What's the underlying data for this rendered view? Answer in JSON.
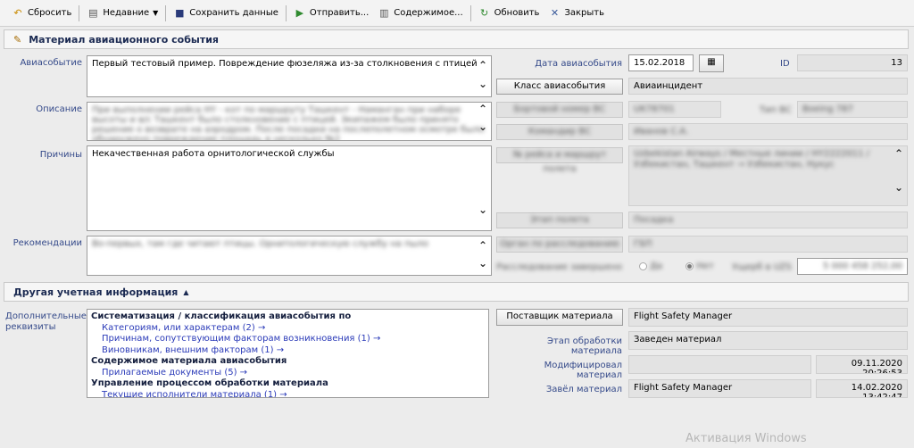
{
  "toolbar": {
    "reset": "Сбросить",
    "recent": "Недавние",
    "save": "Сохранить данные",
    "send": "Отправить...",
    "contents": "Содержимое...",
    "refresh": "Обновить",
    "close": "Закрыть"
  },
  "header": {
    "title": "Материал авиационного события"
  },
  "form": {
    "event_label": "Авиасобытие",
    "event_value": "Первый тестовый пример. Повреждение фюзеляжа из-за столкновения с птицей",
    "description_label": "Описание",
    "description_value": "При выполнении рейса HY - кот по маршруту Ташкент - Наманган при наборе высоты и в/с Ташкент было столкновение с птицей. Экипажем было принято решение о возврате на аэродром. После посадки на послеполетном осмотре было обнаружено повреждение площадь в несколько №2",
    "causes_label": "Причины",
    "causes_value": "Некачественная работа орнитологической службы",
    "recommendations_label": "Рекомендации",
    "recommendations_value": "Во-первых, там где читают птицы. Орнитологическую службу на пыло",
    "date_label": "Дата авиасобытия",
    "date_value": "15.02.2018",
    "id_label": "ID",
    "id_value": "13",
    "class_button": "Класс авиасобытия",
    "class_value": "Авиаинцидент",
    "board_button": "Бортовой номер ВС",
    "board_value": "UK78701",
    "type_label": "Тип ВС",
    "type_value": "Boeing 787",
    "commander_button": "Командир ВС",
    "commander_value": "Иванов С.А.",
    "flight_button": "№ рейса и маршрут полета",
    "flight_value": "Uzbekistan Airways / Местные линии / HY2222011 / Узбекистан, Ташкент → Узбекистан, Нукус",
    "phase_button": "Этап полета",
    "phase_value": "Посадка",
    "organ_button": "Орган по расследованию",
    "organ_value": "ГБП",
    "investigation_label": "Расследование завершено",
    "yes_label": "Да",
    "no_label": "Нет",
    "damage_label": "Ущерб в UZS",
    "damage_value": "5 000 458 252,00"
  },
  "other": {
    "title": "Другая учетная информация",
    "extra_label": "Дополнительные реквизиты",
    "groups": [
      {
        "heading": "Систематизация / классификация авиасобытия по"
      },
      {
        "link": "Категориям, или характерам (2) →"
      },
      {
        "link": "Причинам, сопутствующим факторам возникновения (1) →"
      },
      {
        "link": "Виновникам, внешним факторам (1) →"
      },
      {
        "heading": "Содержимое материала авиасобытия"
      },
      {
        "link": "Прилагаемые документы (5) →"
      },
      {
        "heading": "Управление процессом обработки материала"
      },
      {
        "link": "Текущие исполнители материала (1) →"
      }
    ],
    "supplier_button": "Поставщик материала",
    "supplier_value": "Flight Safety Manager",
    "stage_label": "Этап обработки материала",
    "stage_value": "Заведен материал",
    "modified_label": "Модифицировал материал",
    "modified_value": "",
    "modified_date": "09.11.2020 20:26:53",
    "created_label": "Завёл материал",
    "created_value": "Flight Safety Manager",
    "created_date": "14.02.2020 13:42:47"
  },
  "watermark": "Активация Windows",
  "icons": [
    "reset-icon",
    "recent-icon",
    "save-icon",
    "send-icon",
    "contents-icon",
    "refresh-icon",
    "close-icon",
    "edit-icon",
    "calendar-icon",
    "chevron-up-icon",
    "chevron-down-icon"
  ]
}
